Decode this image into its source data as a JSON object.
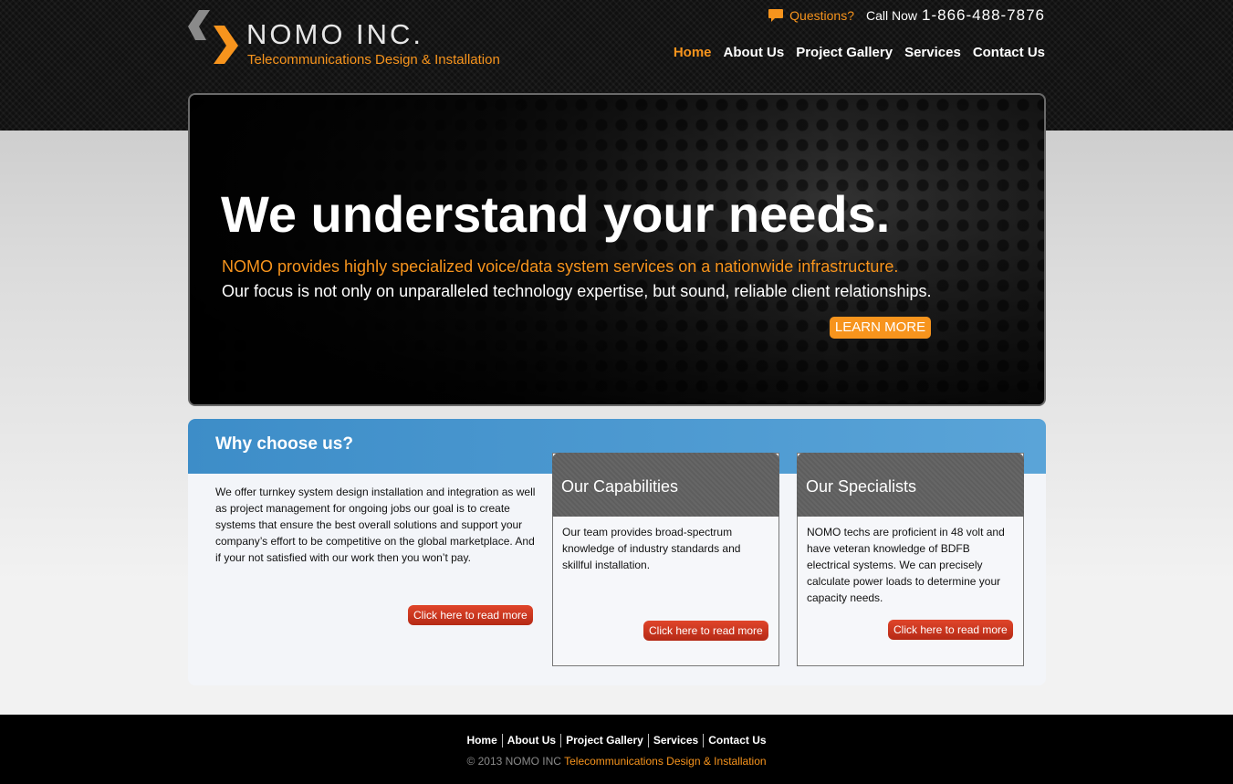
{
  "header": {
    "logo": {
      "name": "NOMO INC.",
      "tagline": "Telecommunications Design & Installation"
    },
    "contact": {
      "questions": "Questions?",
      "call_now": "Call Now",
      "phone": "1-866-488-7876"
    },
    "nav": [
      {
        "label": "Home",
        "active": true
      },
      {
        "label": "About Us"
      },
      {
        "label": "Project Gallery"
      },
      {
        "label": "Services"
      },
      {
        "label": "Contact Us"
      }
    ]
  },
  "hero": {
    "title": "We understand your needs.",
    "subtitle_orange": "NOMO provides highly specialized voice/data system services on a nationwide infrastructure.",
    "subtitle_white": "Our focus is not only on unparalleled technology expertise, but sound, reliable client relationships.",
    "button": "LEARN MORE"
  },
  "why": {
    "title": "Why choose us?",
    "text": "We offer turnkey system design installation and integration as well as project management for ongoing jobs our goal is to create systems that ensure the best overall solutions and support your company’s effort to be competitive on the global marketplace. And if your not satisfied with our work then you won’t pay.",
    "button": "Click here to read more"
  },
  "cards": [
    {
      "title": "Our Capabilities",
      "text": "Our team provides broad-spectrum knowledge of industry standards and skillful installation.",
      "button": "Click here to read more"
    },
    {
      "title": "Our Specialists",
      "text": "NOMO techs are proficient in 48 volt and have veteran knowledge of BDFB electrical systems. We can precisely calculate power loads to determine your capacity needs.",
      "button": "Click here to read more"
    }
  ],
  "footer": {
    "nav": [
      "Home",
      "About Us",
      "Project Gallery",
      "Services",
      "Contact Us"
    ],
    "copyright": "© 2013 NOMO INC",
    "tagline": "Telecommunications Design & Installation"
  },
  "colors": {
    "accent": "#f7941d",
    "why_header": "#3d8dc8",
    "button_red": "#c83a22"
  },
  "icons": {
    "logo_mark": "chevron-logo-icon",
    "questions": "chat-bubble-icon"
  }
}
